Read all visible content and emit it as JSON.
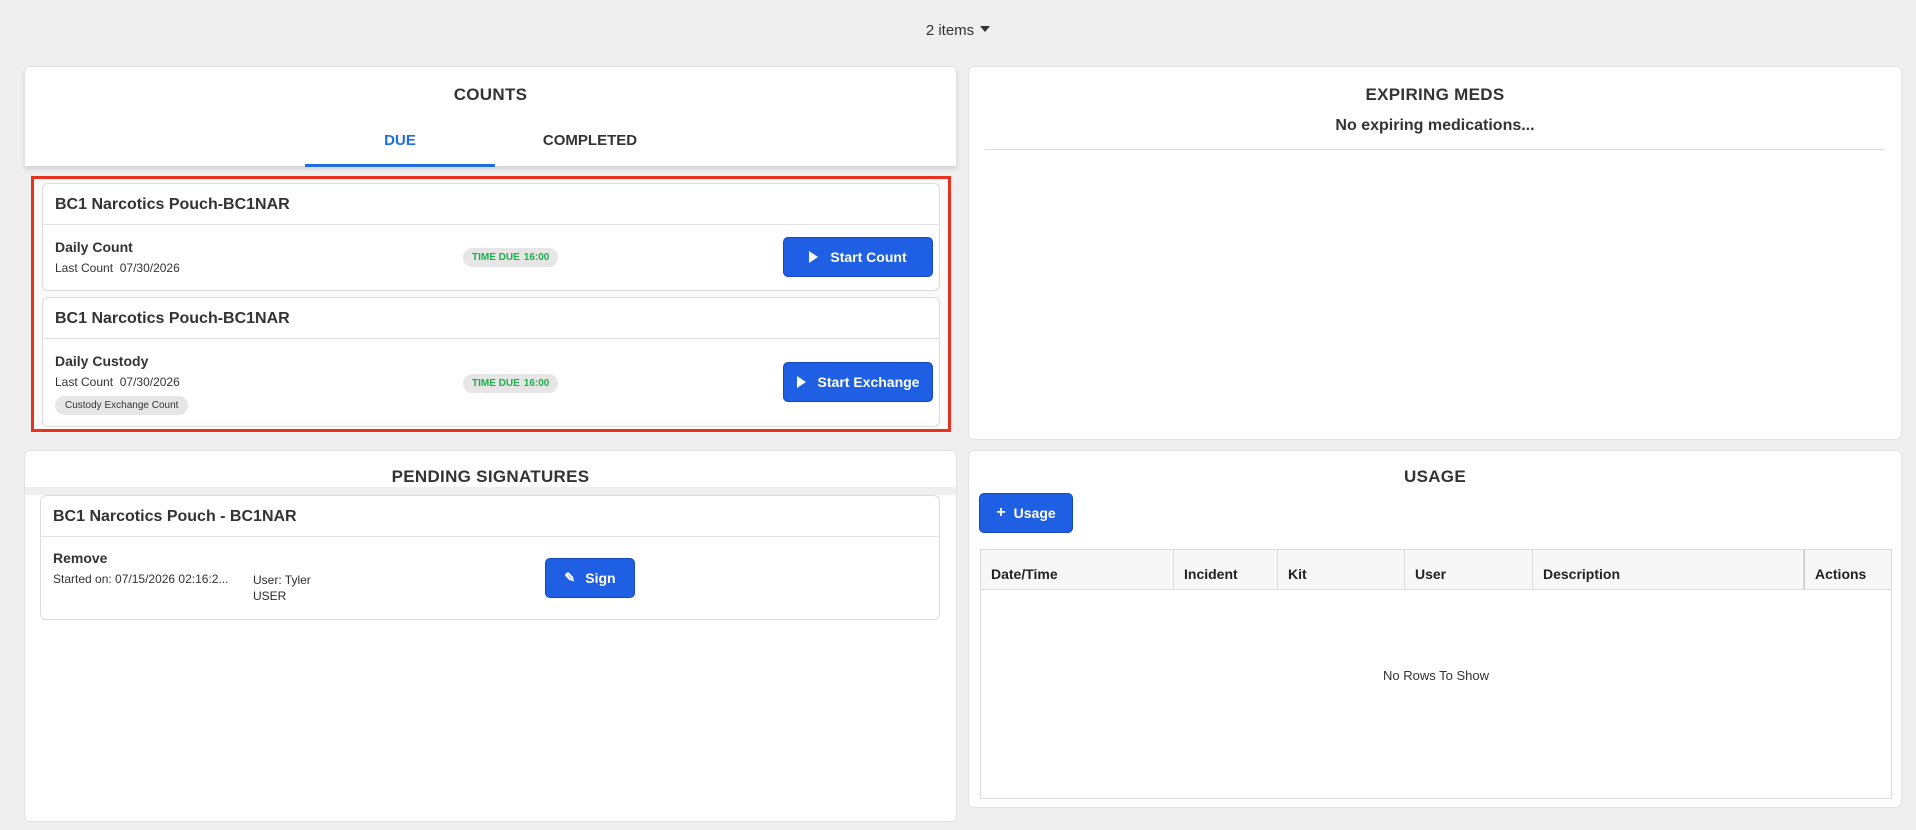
{
  "header": {
    "items_selector": "2 items"
  },
  "counts": {
    "title": "COUNTS",
    "tabs": [
      {
        "label": "DUE",
        "active": true
      },
      {
        "label": "COMPLETED",
        "active": false
      }
    ],
    "highlight_color": "#e8321e",
    "cards": [
      {
        "header": "BC1 Narcotics Pouch-BC1NAR",
        "title": "Daily Count",
        "last_count_label": "Last Count",
        "last_count_date": "07/30/2026",
        "time_due_label": "TIME DUE",
        "time_due_value": "16:00",
        "button_label": "Start Count",
        "chip": ""
      },
      {
        "header": "BC1 Narcotics Pouch-BC1NAR",
        "title": "Daily Custody",
        "last_count_label": "Last Count",
        "last_count_date": "07/30/2026",
        "time_due_label": "TIME DUE",
        "time_due_value": "16:00",
        "button_label": "Start Exchange",
        "chip": "Custody Exchange Count"
      }
    ]
  },
  "expiring_meds": {
    "title": "EXPIRING MEDS",
    "empty_message": "No expiring medications..."
  },
  "pending_signatures": {
    "title": "PENDING SIGNATURES",
    "card": {
      "header": "BC1 Narcotics Pouch - BC1NAR",
      "action": "Remove",
      "started_on": "Started on: 07/15/2026 02:16:2...",
      "user_line1": "User: Tyler",
      "user_line2": "USER",
      "button_label": "Sign"
    }
  },
  "usage": {
    "title": "USAGE",
    "add_button_label": "Usage",
    "columns": [
      "Date/Time",
      "Incident",
      "Kit",
      "User",
      "Description",
      "Actions"
    ],
    "empty_message": "No Rows To Show"
  },
  "colors": {
    "accent": "#1f5fe3",
    "tab_active": "#1f6fe0",
    "badge_text": "#1eae4a"
  },
  "icons": {
    "items_caret": "chevron-down-icon",
    "start": "play-icon",
    "sign": "pencil-icon",
    "add": "plus-icon"
  }
}
